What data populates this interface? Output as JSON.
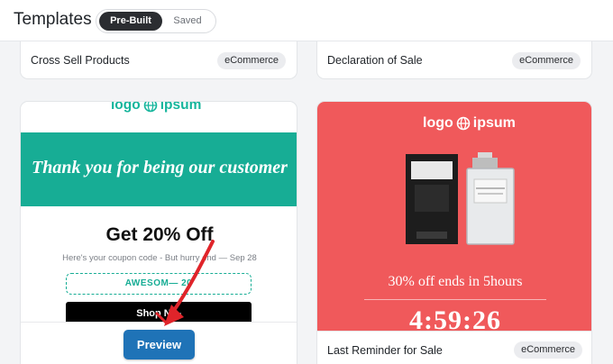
{
  "header": {
    "title": "Templates",
    "tabs": [
      {
        "label": "Pre-Built",
        "active": true
      },
      {
        "label": "Saved",
        "active": false
      }
    ]
  },
  "templates": {
    "cross_sell": {
      "name": "Cross Sell Products",
      "category": "eCommerce"
    },
    "declaration": {
      "name": "Declaration of Sale",
      "category": "eCommerce"
    },
    "thank_you": {
      "logo": "logo ipsum",
      "headline": "Thank you for being our customer",
      "offer": "Get 20% Off",
      "coupon_note": "Here's your coupon code - But hurry end — Sep 28",
      "coupon_code": "AWESOM— 20",
      "shop_label": "Shop N—",
      "preview_label": "Preview"
    },
    "last_reminder": {
      "logo": "logo ipsum",
      "promo": "30% off ends in 5hours",
      "countdown": "4:59:26",
      "name": "Last Reminder for Sale",
      "category": "eCommerce"
    }
  },
  "colors": {
    "teal": "#17ad95",
    "coral": "#f0595b",
    "preview_blue": "#1f73b7",
    "annotation_red": "#e0242a"
  }
}
